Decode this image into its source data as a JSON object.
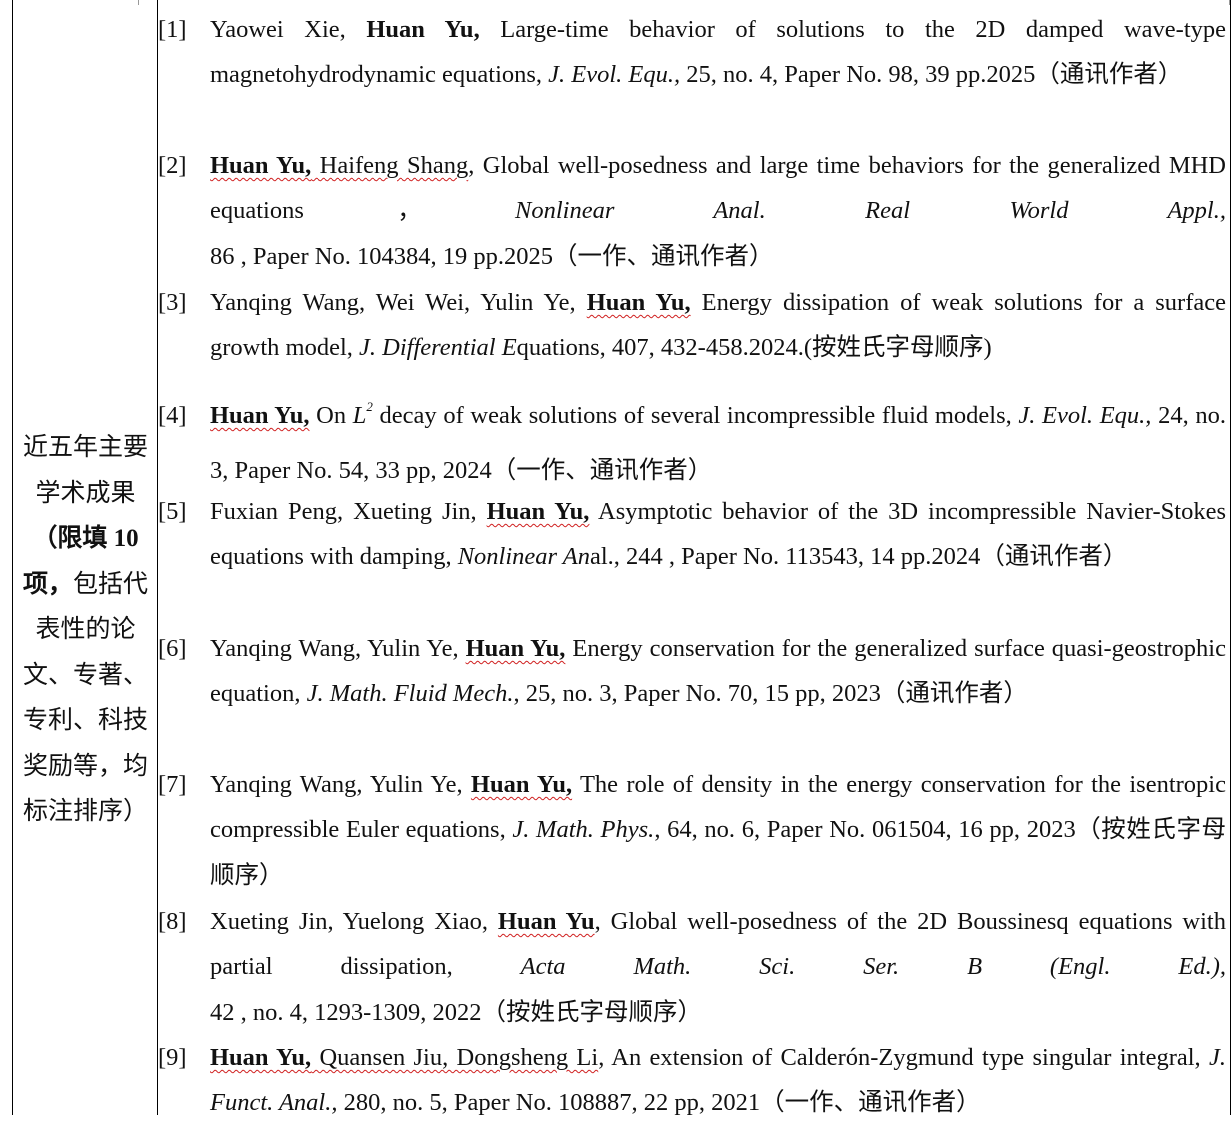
{
  "label": {
    "line1": "近五年主要",
    "line2": "学术成果",
    "line3": "（限填 10",
    "line4_bold": "项，",
    "line4_rest": "包括代",
    "line5": "表性的论",
    "line6": "文、专著、",
    "line7": "专利、科技",
    "line8": "奖励等，均",
    "line9": "标注排序）"
  },
  "references": [
    {
      "num": "[1]",
      "authors_before": "Yaowei Xie, ",
      "highlight": "Huan Yu,",
      "authors_after": "",
      "title": " Large-time behavior of solutions to the 2D damped wave-type magnetohydrodynamic equations, ",
      "journal": "J. Evol. Equ.,",
      "details": " 25,   no. 4, Paper No. 98, 39 pp.2025（通讯作者）"
    },
    {
      "num": "[2]",
      "authors_before": "",
      "highlight": "Huan Yu,",
      "authors_after": " Haifeng Shang",
      "title": ", Global well-posedness and large time behaviors for the generalized MHD equations，",
      "journal": "Nonlinear Anal. Real World Appl.,",
      "details": " 86 , Paper No. 104384, 19 pp.2025（一作、通讯作者）"
    },
    {
      "num": "[3]",
      "authors_before": "Yanqing Wang, Wei Wei, Yulin Ye, ",
      "highlight": "Huan Yu,",
      "authors_after": "",
      "title": " Energy dissipation of weak solutions for a surface growth model, ",
      "journal": "J. Differential E",
      "details": "quations, 407, 432-458.2024.(按姓氏字母顺序)"
    },
    {
      "num": "[4]",
      "authors_before": "",
      "highlight": "Huan Yu,",
      "authors_after": "",
      "title_prefix": " On ",
      "math": "L",
      "math_sup": "2",
      "title": " decay of weak solutions of several incompressible fluid models, ",
      "journal": "J. Evol. Equ.,",
      "details": " 24, no. 3, Paper No. 54, 33 pp, 2024（一作、通讯作者）"
    },
    {
      "num": "[5]",
      "authors_before": "Fuxian Peng, Xueting Jin, ",
      "highlight": "Huan Yu,",
      "authors_after": "",
      "title": "  Asymptotic behavior of the 3D incompressible Navier-Stokes equations with damping, ",
      "journal": "Nonlinear An",
      "details": "al., 244 , Paper No. 113543, 14 pp.2024（通讯作者）"
    },
    {
      "num": "[6]",
      "authors_before": "Yanqing Wang, Yulin Ye, ",
      "highlight": "Huan Yu,",
      "authors_after": "",
      "title": " Energy conservation for the generalized surface quasi-geostrophic equation, ",
      "journal": "J. Math. Fluid Mech.",
      "details": ", 25, no. 3, Paper No. 70, 15 pp, 2023（通讯作者）"
    },
    {
      "num": "[7]",
      "authors_before": "Yanqing Wang, Yulin Ye, ",
      "highlight": "Huan Yu,",
      "authors_after": "",
      "title": " The role of density in the energy conservation for the isentropic compressible Euler equations, ",
      "journal": "J. Math. Phys.",
      "details": ", 64, no. 6, Paper No. 061504, 16 pp, 2023（按姓氏字母顺序）"
    },
    {
      "num": "[8]",
      "authors_before": "Xueting Jin, Yuelong Xiao, ",
      "highlight": "Huan Yu",
      "authors_after": "",
      "title": ", Global well-posedness of the 2D Boussinesq equations with partial dissipation, ",
      "journal": "Acta Math. Sci. Ser. B (Engl. Ed.),",
      "details": " 42 , no. 4, 1293-1309, 2022（按姓氏字母顺序）"
    },
    {
      "num": "[9]",
      "authors_before": "",
      "highlight": "Huan Yu,",
      "authors_after": " Quansen Jiu, Dongsheng Li",
      "title": ", An extension of Calderón-Zygmund type singular integral, ",
      "journal": "J. Funct. Anal.,",
      "details": " 280, no. 5, Paper No. 108887, 22 pp, 2021（一作、通讯作者）"
    }
  ]
}
